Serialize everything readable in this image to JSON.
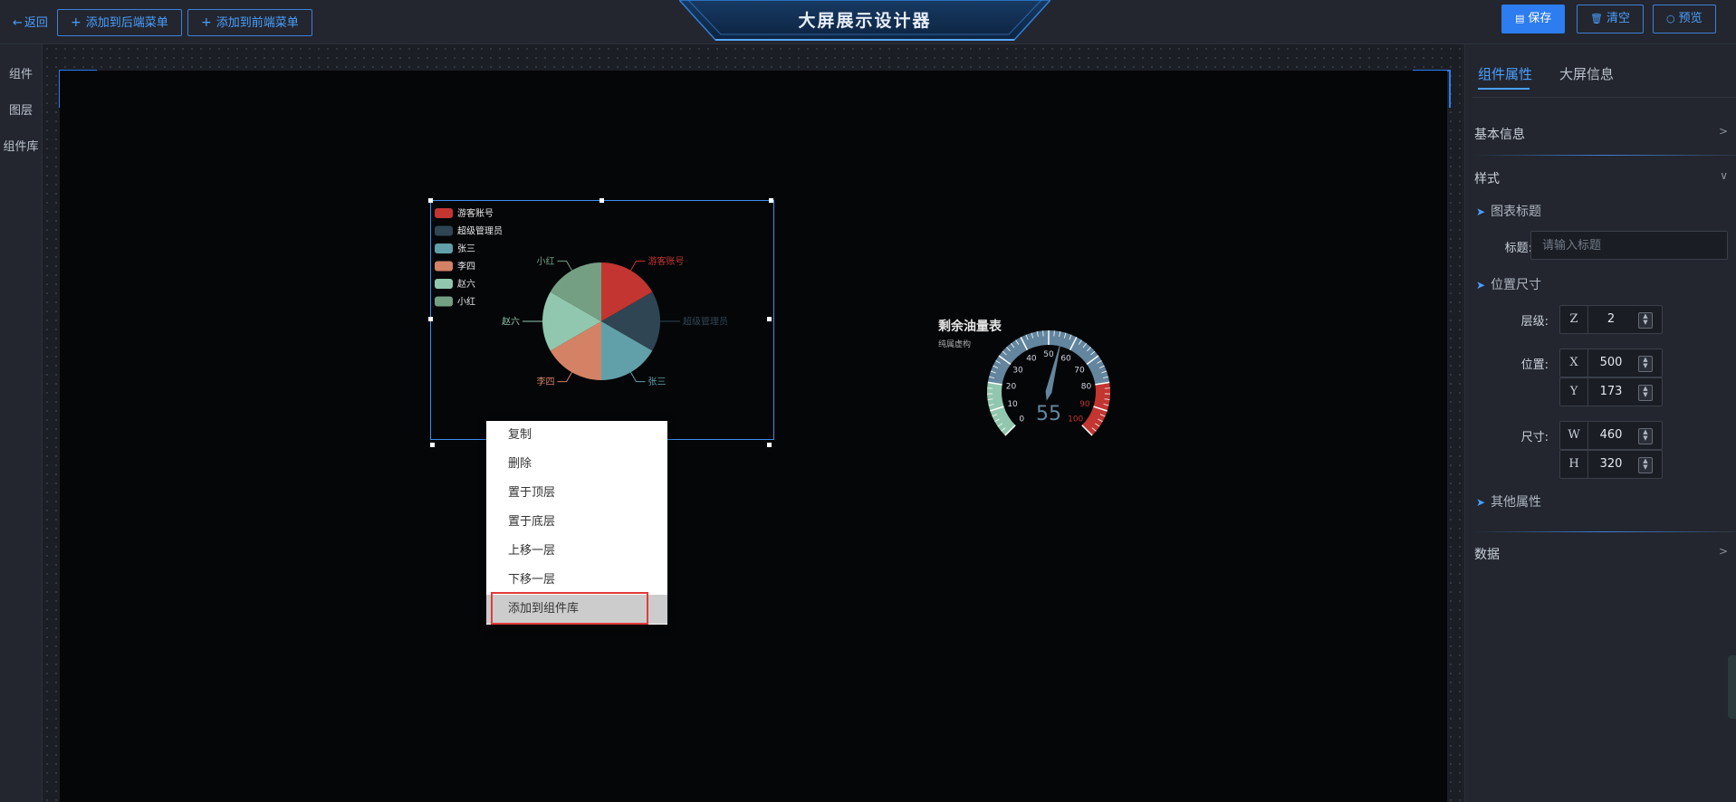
{
  "topbar": {
    "back_label": "返回",
    "add_back_menu": "添加到后端菜单",
    "add_front_menu": "添加到前端菜单",
    "title": "大屏展示设计器",
    "save": "保存",
    "clear": "清空",
    "preview": "预览"
  },
  "leftnav": {
    "items": [
      "组件",
      "图层",
      "组件库"
    ]
  },
  "context_menu": {
    "items": [
      "复制",
      "删除",
      "置于顶层",
      "置于底层",
      "上移一层",
      "下移一层",
      "添加到组件库"
    ],
    "highlighted_index": 6
  },
  "pie_widget": {
    "chart_data": {
      "type": "pie",
      "title": "",
      "legend_position": "top-left",
      "slices": [
        {
          "name": "游客账号",
          "value": 1,
          "color": "#c23531"
        },
        {
          "name": "超级管理员",
          "value": 1,
          "color": "#2f4554"
        },
        {
          "name": "张三",
          "value": 1,
          "color": "#61a0a8"
        },
        {
          "name": "李四",
          "value": 1,
          "color": "#d48265"
        },
        {
          "name": "赵六",
          "value": 1,
          "color": "#91c7ae"
        },
        {
          "name": "小红",
          "value": 1,
          "color": "#749f83"
        }
      ]
    }
  },
  "gauge_widget": {
    "chart_data": {
      "type": "gauge",
      "title": "剩余油量表",
      "subtitle": "纯属虚构",
      "min": 0,
      "max": 100,
      "value": 55,
      "tick_labels": [
        "0",
        "10",
        "20",
        "30",
        "40",
        "50",
        "60",
        "70",
        "80",
        "90",
        "100"
      ],
      "value_label": "55",
      "band_colors": {
        "low": "#91c7ae",
        "mid": "#63869e",
        "high": "#c23531"
      }
    }
  },
  "rightpanel": {
    "tabs": [
      "组件属性",
      "大屏信息"
    ],
    "sections": {
      "basic": "基本信息",
      "style": "样式",
      "chart_title_group": "图表标题",
      "title_label": "标题:",
      "title_placeholder": "请输入标题",
      "position_group": "位置尺寸",
      "layer_label": "层级:",
      "position_label": "位置:",
      "size_label": "尺寸:",
      "other_group": "其他属性",
      "data": "数据"
    },
    "fields": {
      "z": {
        "axis": "Z",
        "value": "2"
      },
      "x": {
        "axis": "X",
        "value": "500"
      },
      "y": {
        "axis": "Y",
        "value": "173"
      },
      "w": {
        "axis": "W",
        "value": "460"
      },
      "h": {
        "axis": "H",
        "value": "320"
      }
    }
  }
}
